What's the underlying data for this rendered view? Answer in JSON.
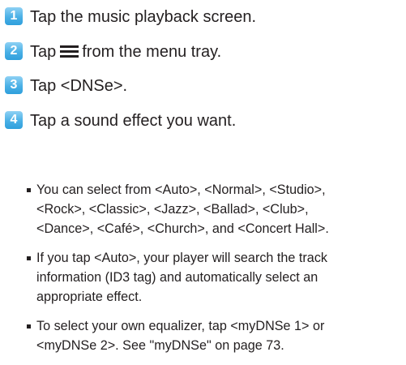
{
  "steps": [
    {
      "number": "1",
      "text": "Tap the music playback screen."
    },
    {
      "number": "2",
      "text_before": "Tap",
      "icon": "menu-icon",
      "text_after": "from the menu tray."
    },
    {
      "number": "3",
      "text": "Tap <DNSe>."
    },
    {
      "number": "4",
      "text": "Tap a sound effect you want."
    }
  ],
  "bullets": [
    {
      "text": "You can select from <Auto>, <Normal>, <Studio>,\n<Rock>, <Classic>, <Jazz>, <Ballad>, <Club>,\n<Dance>, <Café>, <Church>, and <Concert Hall>."
    },
    {
      "text": "If you tap <Auto>, your player will search the track\ninformation (ID3 tag) and automatically select an\nappropriate effect."
    },
    {
      "text": "To select your own equalizer, tap <myDNSe 1> or\n<myDNSe 2>. See \"myDNSe\" on page 73."
    }
  ],
  "colors": {
    "badge": "#4ab0e6",
    "text": "#231f20"
  }
}
